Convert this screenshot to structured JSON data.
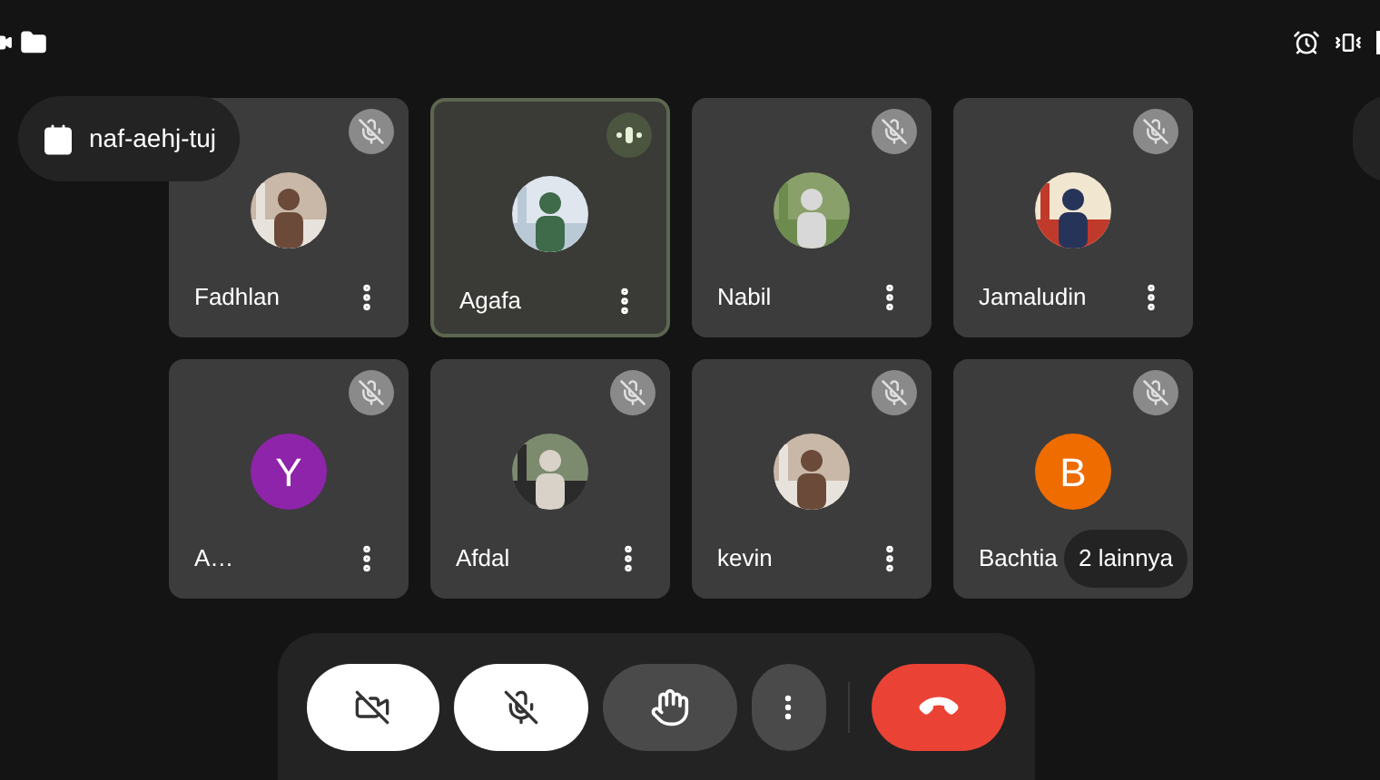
{
  "meeting_code": "naf-aehj-tuj",
  "participants": [
    {
      "name": "Fadhlan",
      "muted": true,
      "speaking": false
    },
    {
      "name": "Agafa",
      "muted": false,
      "speaking": true
    },
    {
      "name": "Nabil",
      "muted": true,
      "speaking": false
    },
    {
      "name": "Jamaludin",
      "muted": true,
      "speaking": false
    },
    {
      "name": "A…",
      "avatar": {
        "kind": "letter",
        "letter": "Y",
        "color": "#8e24aa"
      },
      "muted": true,
      "speaking": false
    },
    {
      "name": "Afdal",
      "muted": true,
      "speaking": false
    },
    {
      "name": "kevin",
      "muted": true,
      "speaking": false
    },
    {
      "name": "Bachtia",
      "avatar": {
        "kind": "letter",
        "letter": "B",
        "color": "#ef6c00"
      },
      "muted": true,
      "speaking": false
    }
  ],
  "more_participants": "2 lainnya",
  "controls": [
    {
      "kind": "camera",
      "on": false
    },
    {
      "kind": "mic",
      "on": false
    },
    {
      "kind": "hand",
      "on": false
    },
    {
      "kind": "more"
    },
    {
      "kind": "end"
    }
  ]
}
